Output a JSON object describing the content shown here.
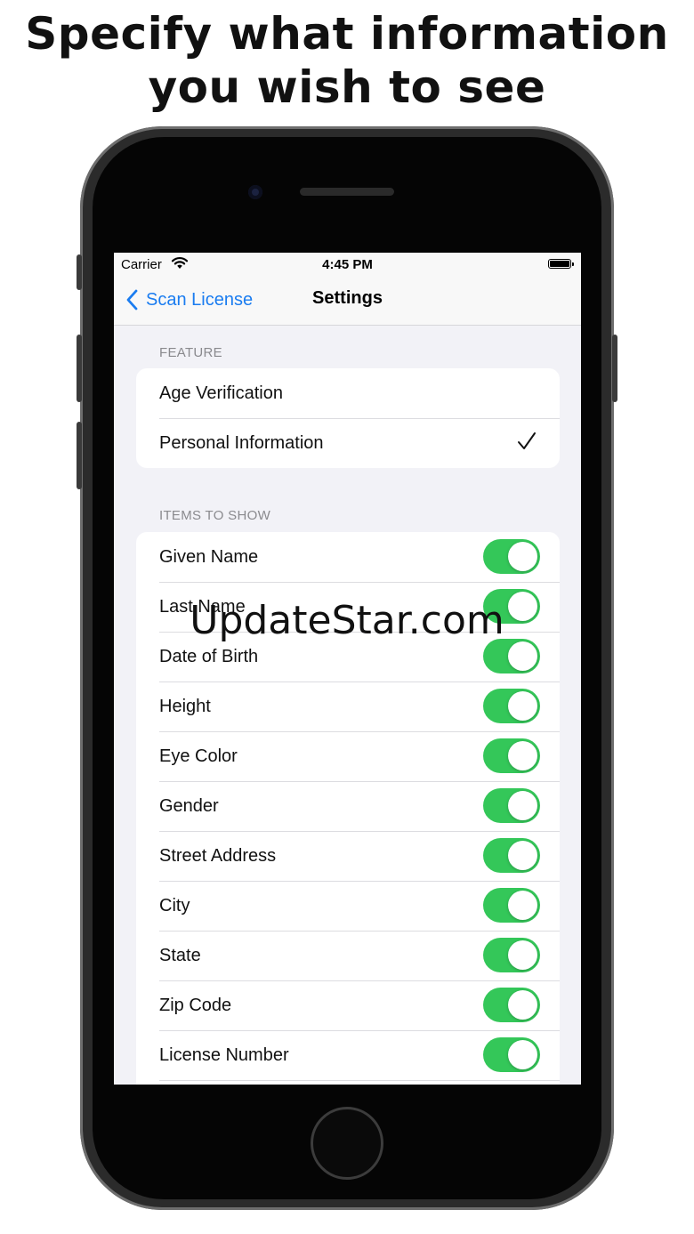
{
  "headline": {
    "line1": "Specify what information",
    "line2": "you wish to see"
  },
  "status_bar": {
    "carrier": "Carrier",
    "time": "4:45 PM"
  },
  "nav": {
    "back_label": "Scan License",
    "title": "Settings"
  },
  "feature_section": {
    "header": "FEATURE",
    "items": [
      {
        "label": "Age Verification",
        "selected": false
      },
      {
        "label": "Personal Information",
        "selected": true
      }
    ]
  },
  "items_section": {
    "header": "ITEMS TO SHOW",
    "items": [
      {
        "label": "Given Name",
        "on": true
      },
      {
        "label": "Last Name",
        "on": true
      },
      {
        "label": "Date of Birth",
        "on": true
      },
      {
        "label": "Height",
        "on": true
      },
      {
        "label": "Eye Color",
        "on": true
      },
      {
        "label": "Gender",
        "on": true
      },
      {
        "label": "Street Address",
        "on": true
      },
      {
        "label": "City",
        "on": true
      },
      {
        "label": "State",
        "on": true
      },
      {
        "label": "Zip Code",
        "on": true
      },
      {
        "label": "License Number",
        "on": true
      }
    ]
  },
  "watermark": "UpdateStar.com",
  "colors": {
    "accent": "#1a7cf0",
    "toggle_on": "#34c759",
    "group_background": "#f2f2f7"
  },
  "icons": {
    "wifi": "wifi-icon",
    "battery": "battery-icon",
    "back": "chevron-left-icon",
    "check": "checkmark-icon"
  }
}
